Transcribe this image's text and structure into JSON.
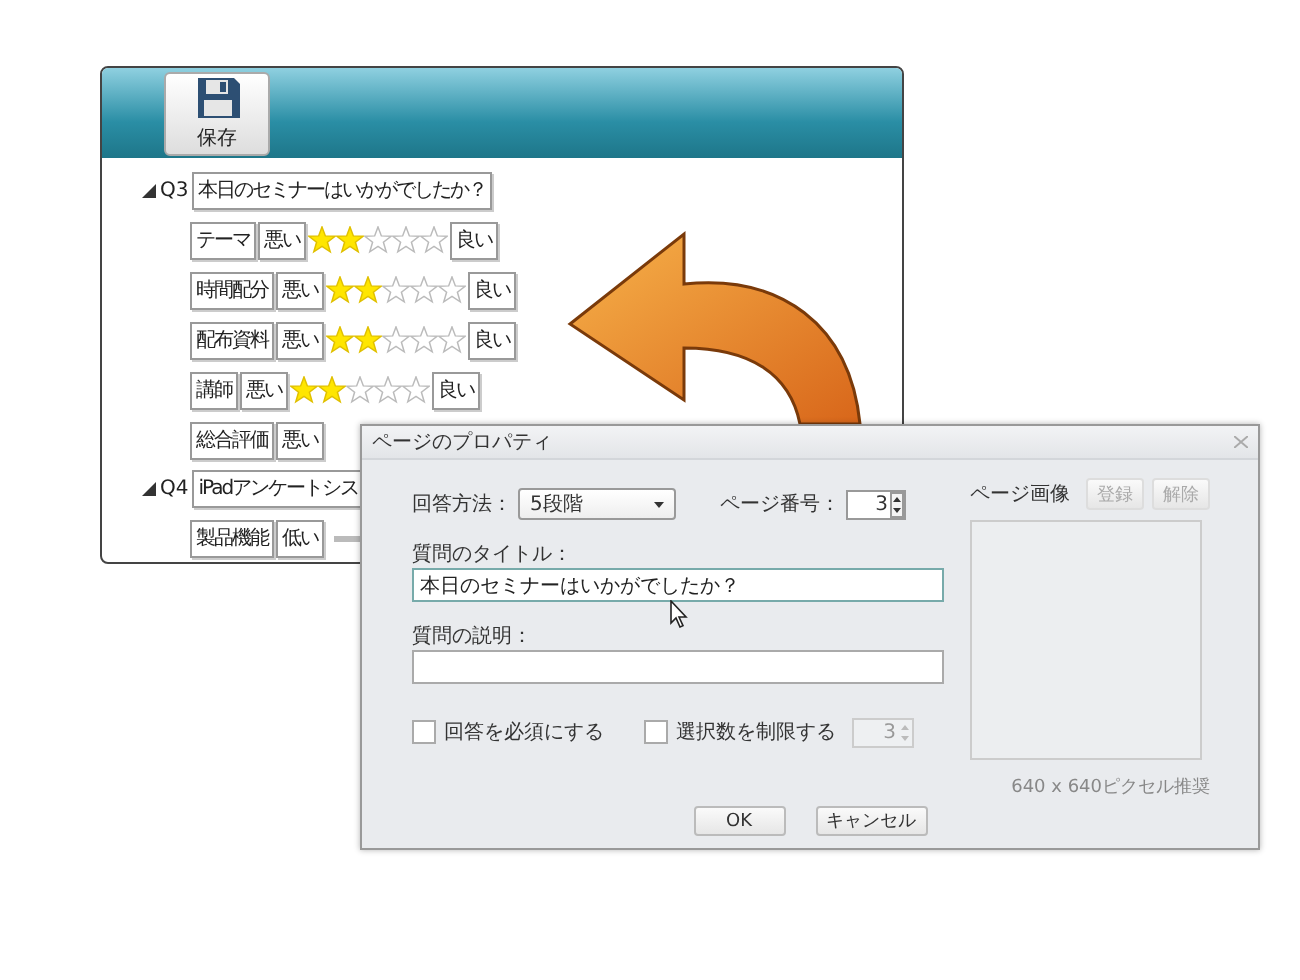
{
  "editor": {
    "toolbar": {
      "save_button": "保存"
    },
    "questions": [
      {
        "number": "Q3",
        "title": "本日のセミナーはいかがでしたか？",
        "expanded": true,
        "items": [
          {
            "kind": "rating",
            "label": "テーマ",
            "low": "悪い",
            "stars": 2,
            "high": "良い"
          },
          {
            "kind": "rating",
            "label": "時間配分",
            "low": "悪い",
            "stars": 2,
            "high": "良い"
          },
          {
            "kind": "rating",
            "label": "配布資料",
            "low": "悪い",
            "stars": 2,
            "high": "良い"
          },
          {
            "kind": "rating",
            "label": "講師",
            "low": "悪い",
            "stars": 2,
            "high": "良い"
          },
          {
            "kind": "rating",
            "label": "総合評価",
            "low": "悪い"
          }
        ]
      },
      {
        "number": "Q4",
        "title": "iPadアンケートシス",
        "expanded": true,
        "items": [
          {
            "kind": "slider",
            "label": "製品機能",
            "low": "低い"
          }
        ]
      }
    ]
  },
  "dialog": {
    "title": "ページのプロパティ",
    "answer_method": {
      "label": "回答方法：",
      "value": "5段階"
    },
    "page_number": {
      "label": "ページ番号：",
      "value": "3"
    },
    "question_title": {
      "label": "質問のタイトル：",
      "value": "本日のセミナーはいかがでしたか？"
    },
    "question_description": {
      "label": "質問の説明："
    },
    "checkboxes": [
      {
        "label": "回答を必須にする",
        "checked": false
      },
      {
        "label": "選択数を制限する",
        "checked": false
      }
    ],
    "limit_spinner": {
      "value": "3",
      "disabled": true
    },
    "page_image": {
      "label": "ページ画像",
      "buttons": [
        {
          "label": "登録",
          "disabled": true
        },
        {
          "label": "解除",
          "disabled": true
        }
      ],
      "hint": "640 x 640ピクセル推奨"
    },
    "buttons": [
      "OK",
      "キャンセル"
    ]
  }
}
